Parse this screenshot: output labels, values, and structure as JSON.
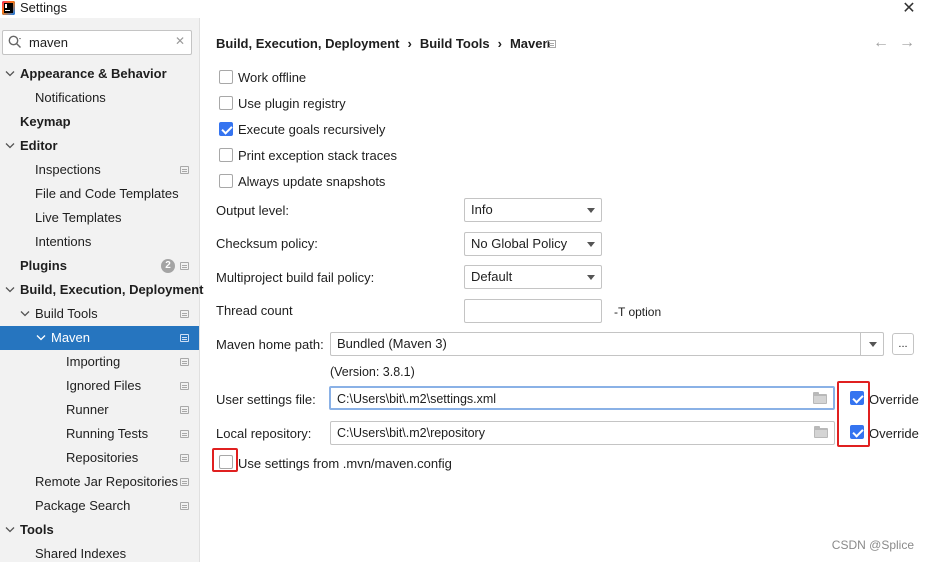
{
  "window": {
    "title": "Settings"
  },
  "search": {
    "value": "maven"
  },
  "sidebar": {
    "items": [
      {
        "label": "Appearance & Behavior"
      },
      {
        "label": "Notifications"
      },
      {
        "label": "Keymap"
      },
      {
        "label": "Editor"
      },
      {
        "label": "Inspections"
      },
      {
        "label": "File and Code Templates"
      },
      {
        "label": "Live Templates"
      },
      {
        "label": "Intentions"
      },
      {
        "label": "Plugins",
        "badge": "2"
      },
      {
        "label": "Build, Execution, Deployment"
      },
      {
        "label": "Build Tools"
      },
      {
        "label": "Maven"
      },
      {
        "label": "Importing"
      },
      {
        "label": "Ignored Files"
      },
      {
        "label": "Runner"
      },
      {
        "label": "Running Tests"
      },
      {
        "label": "Repositories"
      },
      {
        "label": "Remote Jar Repositories"
      },
      {
        "label": "Package Search"
      },
      {
        "label": "Tools"
      },
      {
        "label": "Shared Indexes"
      }
    ]
  },
  "breadcrumb": [
    "Build, Execution, Deployment",
    "Build Tools",
    "Maven"
  ],
  "checkboxes": [
    {
      "label": "Work offline",
      "checked": false
    },
    {
      "label": "Use plugin registry",
      "checked": false
    },
    {
      "label": "Execute goals recursively",
      "checked": true
    },
    {
      "label": "Print exception stack traces",
      "checked": false
    },
    {
      "label": "Always update snapshots",
      "checked": false
    }
  ],
  "fields": {
    "output_level": {
      "label": "Output level:",
      "value": "Info"
    },
    "checksum_policy": {
      "label": "Checksum policy:",
      "value": "No Global Policy"
    },
    "fail_policy": {
      "label": "Multiproject build fail policy:",
      "value": "Default"
    },
    "thread_count": {
      "label": "Thread count",
      "value": "",
      "hint": "-T option"
    },
    "maven_home": {
      "label": "Maven home path:",
      "value": "Bundled (Maven 3)",
      "version": "(Version: 3.8.1)",
      "browse": "..."
    },
    "user_settings": {
      "label": "User settings file:",
      "value": "C:\\Users\\bit\\.m2\\settings.xml",
      "override_label": "Override",
      "override": true
    },
    "local_repo": {
      "label": "Local repository:",
      "value": "C:\\Users\\bit\\.m2\\repository",
      "override_label": "Override",
      "override": true
    },
    "mvn_config": {
      "label": "Use settings from .mvn/maven.config",
      "checked": false
    }
  },
  "watermark": "CSDN @Splice",
  "colors": {
    "selection": "#2675bf",
    "checkbox": "#3574f0",
    "highlight": "#e02020"
  }
}
